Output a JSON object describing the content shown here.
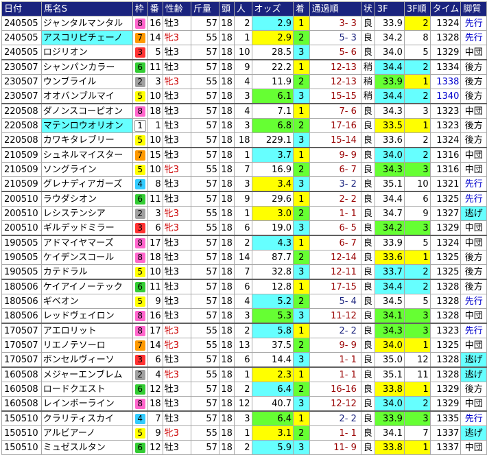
{
  "headers": [
    "日付",
    "馬名S",
    "枠",
    "番",
    "性齢",
    "斤量",
    "頭",
    "人",
    "オッズ",
    "着",
    "通過順",
    "状",
    "3F",
    "3F順",
    "タイム",
    "脚質"
  ],
  "colors": {
    "header_bg": "#1a237e",
    "cyan": "#66ffff",
    "yellow": "#ffff00",
    "green": "#66ff33",
    "waku": {
      "1": "#ffffff",
      "2": "#a0a0a0",
      "3": "#ff3333",
      "4": "#33ccff",
      "5": "#ffff00",
      "6": "#33cc33",
      "7": "#ff9900",
      "8": "#ff66cc"
    }
  },
  "rows": [
    {
      "date": "240505",
      "name": "ジャンタルマンタル",
      "name_hl": "",
      "waku": 8,
      "ban": 16,
      "sex": "牡3",
      "kin": 57,
      "tou": 18,
      "nin": 2,
      "odds": "2.9",
      "odds_hl": "cyan",
      "chaku": 1,
      "tsuka": "3- 3",
      "tsuka_col": "red",
      "jou": "良",
      "f3": "33.9",
      "f3_hl": "",
      "r3": 2,
      "r3_hl": "yellow",
      "time": "1324",
      "time_col": "",
      "kyaku": "先行",
      "kyaku_col": "blue",
      "kyaku_hl": "",
      "sep": false
    },
    {
      "date": "240505",
      "name": "アスコリピチェーノ",
      "name_hl": "cyan",
      "waku": 7,
      "ban": 14,
      "sex": "牝3",
      "kin": 55,
      "tou": 18,
      "nin": 1,
      "odds": "2.9",
      "odds_hl": "yellow",
      "chaku": 2,
      "tsuka": "5- 3",
      "tsuka_col": "blue",
      "jou": "良",
      "f3": "34.2",
      "f3_hl": "",
      "r3": 8,
      "r3_hl": "",
      "time": "1328",
      "time_col": "",
      "kyaku": "先行",
      "kyaku_col": "blue",
      "kyaku_hl": "",
      "sep": false
    },
    {
      "date": "240505",
      "name": "ロジリオン",
      "name_hl": "",
      "waku": 3,
      "ban": 5,
      "sex": "牡3",
      "kin": 57,
      "tou": 18,
      "nin": 10,
      "odds": "28.5",
      "odds_hl": "",
      "chaku": 3,
      "tsuka": "5- 6",
      "tsuka_col": "red",
      "jou": "良",
      "f3": "34.0",
      "f3_hl": "",
      "r3": 5,
      "r3_hl": "",
      "time": "1329",
      "time_col": "",
      "kyaku": "中団",
      "kyaku_col": "",
      "kyaku_hl": "",
      "sep": false
    },
    {
      "date": "230507",
      "name": "シャンパンカラー",
      "name_hl": "",
      "waku": 6,
      "ban": 11,
      "sex": "牡3",
      "kin": 57,
      "tou": 18,
      "nin": 9,
      "odds": "22.2",
      "odds_hl": "",
      "chaku": 1,
      "tsuka": "12-13",
      "tsuka_col": "red",
      "jou": "稍",
      "f3": "34.4",
      "f3_hl": "cyan",
      "r3": 2,
      "r3_hl": "cyan",
      "time": "1334",
      "time_col": "",
      "kyaku": "後方",
      "kyaku_col": "",
      "kyaku_hl": "",
      "sep": true
    },
    {
      "date": "230507",
      "name": "ウンブライル",
      "name_hl": "",
      "waku": 2,
      "ban": 3,
      "sex": "牝3",
      "kin": 55,
      "tou": 18,
      "nin": 4,
      "odds": "11.9",
      "odds_hl": "",
      "chaku": 2,
      "tsuka": "12-13",
      "tsuka_col": "red",
      "jou": "稍",
      "f3": "33.9",
      "f3_hl": "green",
      "r3": 1,
      "r3_hl": "yellow",
      "time": "1338",
      "time_col": "blue",
      "kyaku": "後方",
      "kyaku_col": "",
      "kyaku_hl": "",
      "sep": false
    },
    {
      "date": "230507",
      "name": "オオバンブルマイ",
      "name_hl": "",
      "waku": 5,
      "ban": 10,
      "sex": "牡3",
      "kin": 57,
      "tou": 18,
      "nin": 3,
      "odds": "6.1",
      "odds_hl": "green",
      "chaku": 3,
      "tsuka": "15-15",
      "tsuka_col": "red",
      "jou": "稍",
      "f3": "34.4",
      "f3_hl": "cyan",
      "r3": 2,
      "r3_hl": "cyan",
      "time": "1340",
      "time_col": "blue",
      "kyaku": "後方",
      "kyaku_col": "",
      "kyaku_hl": "",
      "sep": false
    },
    {
      "date": "220508",
      "name": "ダノンスコーピオン",
      "name_hl": "",
      "waku": 8,
      "ban": 18,
      "sex": "牡3",
      "kin": 57,
      "tou": 18,
      "nin": 4,
      "odds": "7.1",
      "odds_hl": "",
      "chaku": 1,
      "tsuka": "7- 6",
      "tsuka_col": "red",
      "jou": "良",
      "f3": "34.3",
      "f3_hl": "",
      "r3": 3,
      "r3_hl": "",
      "time": "1323",
      "time_col": "",
      "kyaku": "中団",
      "kyaku_col": "",
      "kyaku_hl": "",
      "sep": true
    },
    {
      "date": "220508",
      "name": "マテンロウオリオン",
      "name_hl": "cyan",
      "waku": 1,
      "ban": 1,
      "sex": "牡3",
      "kin": 57,
      "tou": 18,
      "nin": 3,
      "odds": "6.8",
      "odds_hl": "green",
      "chaku": 2,
      "tsuka": "17-16",
      "tsuka_col": "red",
      "jou": "良",
      "f3": "33.5",
      "f3_hl": "yellow",
      "r3": 1,
      "r3_hl": "yellow",
      "time": "1323",
      "time_col": "",
      "kyaku": "後方",
      "kyaku_col": "",
      "kyaku_hl": "",
      "sep": false
    },
    {
      "date": "220508",
      "name": "カワキタレブリー",
      "name_hl": "",
      "waku": 5,
      "ban": 10,
      "sex": "牡3",
      "kin": 57,
      "tou": 18,
      "nin": 18,
      "odds": "229.1",
      "odds_hl": "",
      "chaku": 3,
      "tsuka": "15-14",
      "tsuka_col": "red",
      "jou": "良",
      "f3": "33.6",
      "f3_hl": "",
      "r3": 2,
      "r3_hl": "",
      "time": "1324",
      "time_col": "",
      "kyaku": "後方",
      "kyaku_col": "",
      "kyaku_hl": "",
      "sep": false
    },
    {
      "date": "210509",
      "name": "シュネルマイスター",
      "name_hl": "",
      "waku": 7,
      "ban": 15,
      "sex": "牡3",
      "kin": 57,
      "tou": 18,
      "nin": 1,
      "odds": "3.7",
      "odds_hl": "cyan",
      "chaku": 1,
      "tsuka": "9- 9",
      "tsuka_col": "red",
      "jou": "良",
      "f3": "34.0",
      "f3_hl": "cyan",
      "r3": 2,
      "r3_hl": "cyan",
      "time": "1316",
      "time_col": "",
      "kyaku": "中団",
      "kyaku_col": "",
      "kyaku_hl": "",
      "sep": true
    },
    {
      "date": "210509",
      "name": "ソングライン",
      "name_hl": "",
      "waku": 5,
      "ban": 10,
      "sex": "牝3",
      "kin": 55,
      "tou": 18,
      "nin": 7,
      "odds": "16.9",
      "odds_hl": "",
      "chaku": 2,
      "tsuka": "6- 7",
      "tsuka_col": "red",
      "jou": "良",
      "f3": "34.3",
      "f3_hl": "green",
      "r3": 3,
      "r3_hl": "green",
      "time": "1316",
      "time_col": "",
      "kyaku": "中団",
      "kyaku_col": "",
      "kyaku_hl": "",
      "sep": false
    },
    {
      "date": "210509",
      "name": "グレナディアガーズ",
      "name_hl": "",
      "waku": 4,
      "ban": 8,
      "sex": "牡3",
      "kin": 57,
      "tou": 18,
      "nin": 3,
      "odds": "3.4",
      "odds_hl": "yellow",
      "chaku": 3,
      "tsuka": "3- 2",
      "tsuka_col": "blue",
      "jou": "良",
      "f3": "35.1",
      "f3_hl": "",
      "r3": 10,
      "r3_hl": "",
      "time": "1321",
      "time_col": "",
      "kyaku": "先行",
      "kyaku_col": "blue",
      "kyaku_hl": "",
      "sep": false
    },
    {
      "date": "200510",
      "name": "ラウダシオン",
      "name_hl": "",
      "waku": 6,
      "ban": 11,
      "sex": "牡3",
      "kin": 57,
      "tou": 18,
      "nin": 9,
      "odds": "29.6",
      "odds_hl": "",
      "chaku": 1,
      "tsuka": "2- 2",
      "tsuka_col": "red",
      "jou": "良",
      "f3": "34.4",
      "f3_hl": "",
      "r3": 6,
      "r3_hl": "",
      "time": "1325",
      "time_col": "",
      "kyaku": "先行",
      "kyaku_col": "blue",
      "kyaku_hl": "",
      "sep": true
    },
    {
      "date": "200510",
      "name": "レシステンシア",
      "name_hl": "",
      "waku": 2,
      "ban": 3,
      "sex": "牝3",
      "kin": 55,
      "tou": 18,
      "nin": 1,
      "odds": "3.0",
      "odds_hl": "yellow",
      "chaku": 2,
      "tsuka": "1- 1",
      "tsuka_col": "red",
      "jou": "良",
      "f3": "34.7",
      "f3_hl": "",
      "r3": 9,
      "r3_hl": "",
      "time": "1327",
      "time_col": "",
      "kyaku": "逃げ",
      "kyaku_col": "",
      "kyaku_hl": "nige",
      "sep": false
    },
    {
      "date": "200510",
      "name": "ギルデッドミラー",
      "name_hl": "",
      "waku": 3,
      "ban": 6,
      "sex": "牝3",
      "kin": 55,
      "tou": 18,
      "nin": 6,
      "odds": "19.0",
      "odds_hl": "",
      "chaku": 3,
      "tsuka": "6- 5",
      "tsuka_col": "red",
      "jou": "良",
      "f3": "34.2",
      "f3_hl": "green",
      "r3": 3,
      "r3_hl": "green",
      "time": "1329",
      "time_col": "",
      "kyaku": "中団",
      "kyaku_col": "",
      "kyaku_hl": "",
      "sep": false
    },
    {
      "date": "190505",
      "name": "アドマイヤマーズ",
      "name_hl": "",
      "waku": 8,
      "ban": 17,
      "sex": "牡3",
      "kin": 57,
      "tou": 18,
      "nin": 2,
      "odds": "4.3",
      "odds_hl": "cyan",
      "chaku": 1,
      "tsuka": "6- 7",
      "tsuka_col": "red",
      "jou": "良",
      "f3": "33.9",
      "f3_hl": "",
      "r3": 5,
      "r3_hl": "",
      "time": "1324",
      "time_col": "",
      "kyaku": "中団",
      "kyaku_col": "",
      "kyaku_hl": "",
      "sep": true
    },
    {
      "date": "190505",
      "name": "ケイデンスコール",
      "name_hl": "",
      "waku": 8,
      "ban": 18,
      "sex": "牡3",
      "kin": 57,
      "tou": 18,
      "nin": 14,
      "odds": "87.7",
      "odds_hl": "",
      "chaku": 2,
      "tsuka": "12-14",
      "tsuka_col": "red",
      "jou": "良",
      "f3": "33.6",
      "f3_hl": "yellow",
      "r3": 1,
      "r3_hl": "yellow",
      "time": "1325",
      "time_col": "",
      "kyaku": "後方",
      "kyaku_col": "",
      "kyaku_hl": "",
      "sep": false
    },
    {
      "date": "190505",
      "name": "カテドラル",
      "name_hl": "",
      "waku": 5,
      "ban": 10,
      "sex": "牡3",
      "kin": 57,
      "tou": 18,
      "nin": 7,
      "odds": "32.8",
      "odds_hl": "",
      "chaku": 3,
      "tsuka": "12-11",
      "tsuka_col": "red",
      "jou": "良",
      "f3": "33.7",
      "f3_hl": "cyan",
      "r3": 2,
      "r3_hl": "cyan",
      "time": "1325",
      "time_col": "",
      "kyaku": "後方",
      "kyaku_col": "",
      "kyaku_hl": "",
      "sep": false
    },
    {
      "date": "180506",
      "name": "ケイアイノーテック",
      "name_hl": "",
      "waku": 6,
      "ban": 11,
      "sex": "牡3",
      "kin": 57,
      "tou": 18,
      "nin": 6,
      "odds": "12.8",
      "odds_hl": "",
      "chaku": 1,
      "tsuka": "17-15",
      "tsuka_col": "red",
      "jou": "良",
      "f3": "34.4",
      "f3_hl": "cyan",
      "r3": 2,
      "r3_hl": "cyan",
      "time": "1328",
      "time_col": "",
      "kyaku": "後方",
      "kyaku_col": "",
      "kyaku_hl": "",
      "sep": true
    },
    {
      "date": "180506",
      "name": "ギベオン",
      "name_hl": "",
      "waku": 5,
      "ban": 9,
      "sex": "牡3",
      "kin": 57,
      "tou": 18,
      "nin": 4,
      "odds": "5.2",
      "odds_hl": "cyan",
      "chaku": 2,
      "tsuka": "5- 4",
      "tsuka_col": "blue",
      "jou": "良",
      "f3": "34.5",
      "f3_hl": "",
      "r3": 5,
      "r3_hl": "",
      "time": "1328",
      "time_col": "",
      "kyaku": "先行",
      "kyaku_col": "blue",
      "kyaku_hl": "",
      "sep": false
    },
    {
      "date": "180506",
      "name": "レッドヴェイロン",
      "name_hl": "",
      "waku": 8,
      "ban": 16,
      "sex": "牡3",
      "kin": 57,
      "tou": 18,
      "nin": 3,
      "odds": "5.3",
      "odds_hl": "green",
      "chaku": 3,
      "tsuka": "11-12",
      "tsuka_col": "red",
      "jou": "良",
      "f3": "34.1",
      "f3_hl": "green",
      "r3": 3,
      "r3_hl": "green",
      "time": "1328",
      "time_col": "",
      "kyaku": "中団",
      "kyaku_col": "",
      "kyaku_hl": "",
      "sep": false
    },
    {
      "date": "170507",
      "name": "アエロリット",
      "name_hl": "",
      "waku": 8,
      "ban": 17,
      "sex": "牝3",
      "kin": 55,
      "tou": 18,
      "nin": 2,
      "odds": "5.8",
      "odds_hl": "cyan",
      "chaku": 1,
      "tsuka": "2- 2",
      "tsuka_col": "blue",
      "jou": "良",
      "f3": "34.3",
      "f3_hl": "green",
      "r3": 3,
      "r3_hl": "green",
      "time": "1323",
      "time_col": "",
      "kyaku": "先行",
      "kyaku_col": "blue",
      "kyaku_hl": "",
      "sep": true
    },
    {
      "date": "170507",
      "name": "リエノテソーロ",
      "name_hl": "",
      "waku": 7,
      "ban": 14,
      "sex": "牝3",
      "kin": 55,
      "tou": 18,
      "nin": 13,
      "odds": "37.5",
      "odds_hl": "",
      "chaku": 2,
      "tsuka": "9- 9",
      "tsuka_col": "red",
      "jou": "良",
      "f3": "34.0",
      "f3_hl": "yellow",
      "r3": 1,
      "r3_hl": "yellow",
      "time": "1325",
      "time_col": "",
      "kyaku": "中団",
      "kyaku_col": "",
      "kyaku_hl": "",
      "sep": false
    },
    {
      "date": "170507",
      "name": "ボンセルヴィーソ",
      "name_hl": "",
      "waku": 3,
      "ban": 6,
      "sex": "牡3",
      "kin": 57,
      "tou": 18,
      "nin": 6,
      "odds": "14.4",
      "odds_hl": "",
      "chaku": 3,
      "tsuka": "1- 1",
      "tsuka_col": "red",
      "jou": "良",
      "f3": "35.0",
      "f3_hl": "",
      "r3": 12,
      "r3_hl": "",
      "time": "1328",
      "time_col": "",
      "kyaku": "逃げ",
      "kyaku_col": "",
      "kyaku_hl": "nige",
      "sep": false
    },
    {
      "date": "160508",
      "name": "メジャーエンブレム",
      "name_hl": "",
      "waku": 2,
      "ban": 4,
      "sex": "牝3",
      "kin": 55,
      "tou": 18,
      "nin": 1,
      "odds": "2.3",
      "odds_hl": "yellow",
      "chaku": 1,
      "tsuka": "1- 1",
      "tsuka_col": "red",
      "jou": "良",
      "f3": "35.1",
      "f3_hl": "",
      "r3": 11,
      "r3_hl": "",
      "time": "1328",
      "time_col": "",
      "kyaku": "逃げ",
      "kyaku_col": "",
      "kyaku_hl": "nige",
      "sep": true
    },
    {
      "date": "160508",
      "name": "ロードクエスト",
      "name_hl": "",
      "waku": 6,
      "ban": 12,
      "sex": "牡3",
      "kin": 57,
      "tou": 18,
      "nin": 2,
      "odds": "6.4",
      "odds_hl": "cyan",
      "chaku": 2,
      "tsuka": "16-16",
      "tsuka_col": "red",
      "jou": "良",
      "f3": "33.8",
      "f3_hl": "yellow",
      "r3": 1,
      "r3_hl": "yellow",
      "time": "1329",
      "time_col": "",
      "kyaku": "後方",
      "kyaku_col": "",
      "kyaku_hl": "",
      "sep": false
    },
    {
      "date": "160508",
      "name": "レインボーライン",
      "name_hl": "",
      "waku": 8,
      "ban": 18,
      "sex": "牡3",
      "kin": 57,
      "tou": 18,
      "nin": 12,
      "odds": "40.7",
      "odds_hl": "",
      "chaku": 3,
      "tsuka": "12-12",
      "tsuka_col": "red",
      "jou": "良",
      "f3": "34.0",
      "f3_hl": "cyan",
      "r3": 2,
      "r3_hl": "cyan",
      "time": "1329",
      "time_col": "",
      "kyaku": "中団",
      "kyaku_col": "",
      "kyaku_hl": "",
      "sep": false
    },
    {
      "date": "150510",
      "name": "クラリティスカイ",
      "name_hl": "",
      "waku": 4,
      "ban": 7,
      "sex": "牡3",
      "kin": 57,
      "tou": 18,
      "nin": 3,
      "odds": "6.4",
      "odds_hl": "green",
      "chaku": 1,
      "tsuka": "2- 2",
      "tsuka_col": "blue",
      "jou": "良",
      "f3": "33.9",
      "f3_hl": "green",
      "r3": 3,
      "r3_hl": "green",
      "time": "1335",
      "time_col": "",
      "kyaku": "先行",
      "kyaku_col": "blue",
      "kyaku_hl": "",
      "sep": true
    },
    {
      "date": "150510",
      "name": "アルビアーノ",
      "name_hl": "",
      "waku": 5,
      "ban": 9,
      "sex": "牝3",
      "kin": 55,
      "tou": 18,
      "nin": 1,
      "odds": "3.1",
      "odds_hl": "yellow",
      "chaku": 2,
      "tsuka": "1- 1",
      "tsuka_col": "red",
      "jou": "良",
      "f3": "34.1",
      "f3_hl": "",
      "r3": 7,
      "r3_hl": "",
      "time": "1337",
      "time_col": "",
      "kyaku": "逃げ",
      "kyaku_col": "",
      "kyaku_hl": "nige",
      "sep": false
    },
    {
      "date": "150510",
      "name": "ミュゼスルタン",
      "name_hl": "",
      "waku": 6,
      "ban": 12,
      "sex": "牡3",
      "kin": 57,
      "tou": 18,
      "nin": 2,
      "odds": "5.9",
      "odds_hl": "cyan",
      "chaku": 3,
      "tsuka": "11- 9",
      "tsuka_col": "red",
      "jou": "良",
      "f3": "33.8",
      "f3_hl": "yellow",
      "r3": 1,
      "r3_hl": "yellow",
      "time": "1337",
      "time_col": "",
      "kyaku": "中団",
      "kyaku_col": "",
      "kyaku_hl": "",
      "sep": false
    }
  ]
}
